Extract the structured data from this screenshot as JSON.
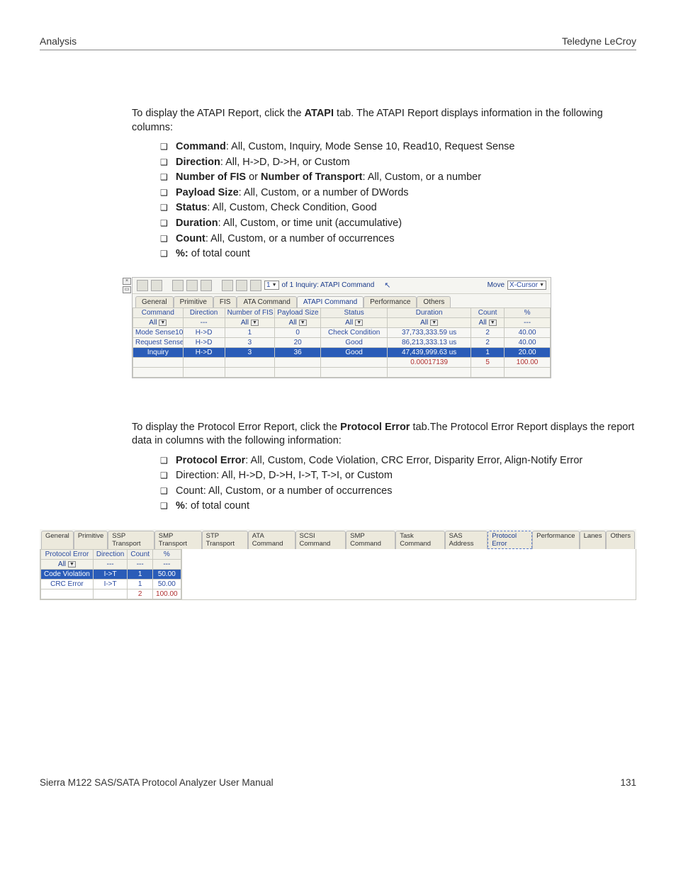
{
  "header": {
    "left": "Analysis",
    "right": "Teledyne LeCroy"
  },
  "atapi_text": {
    "intro_before": "To display the ATAPI Report, click the ",
    "intro_bold": "ATAPI",
    "intro_after": " tab. The ATAPI Report displays information in the following columns:",
    "items": [
      {
        "b": "Command",
        "t": ": All, Custom, Inquiry, Mode Sense 10, Read10, Request Sense"
      },
      {
        "b": "Direction",
        "t": ": All, H->D, D->H, or Custom"
      },
      {
        "b": "Number of FIS",
        "mid": " or ",
        "b2": "Number of Transport",
        "t": ": All, Custom, or a number"
      },
      {
        "b": "Payload Size",
        "t": ": All, Custom, or a number of DWords"
      },
      {
        "b": "Status",
        "t": ": All, Custom, Check Condition, Good"
      },
      {
        "b": "Duration",
        "t": ": All, Custom, or time unit (accumulative)"
      },
      {
        "b": "Count",
        "t": ": All, Custom, or a number of occurrences"
      },
      {
        "b": "%:",
        "t": " of total count"
      }
    ]
  },
  "atapi_ss": {
    "nav_text": "of 1  Inquiry: ATAPI Command",
    "move": "Move",
    "cursor": "X-Cursor",
    "tabs": [
      "General",
      "Primitive",
      "FIS",
      "ATA Command",
      "ATAPI Command",
      "Performance",
      "Others"
    ],
    "active_tab": 4,
    "headers": [
      "Command",
      "Direction",
      "Number of FIS",
      "Payload Size",
      "Status",
      "Duration",
      "Count",
      "%"
    ],
    "filter": [
      "All",
      "---",
      "All",
      "All",
      "All",
      "All",
      "All",
      "---"
    ],
    "rows": [
      [
        "Mode Sense10",
        "H->D",
        "1",
        "0",
        "Check Condition",
        "37,733,333.59  us",
        "2",
        "40.00"
      ],
      [
        "Request Sense",
        "H->D",
        "3",
        "20",
        "Good",
        "86,213,333.13  us",
        "2",
        "40.00"
      ],
      [
        "Inquiry",
        "H->D",
        "3",
        "36",
        "Good",
        "47,439,999.63  us",
        "1",
        "20.00"
      ],
      [
        "",
        "",
        "",
        "",
        "",
        "0.00017139",
        "5",
        "100.00"
      ]
    ],
    "selected_row_index": 2
  },
  "perr_text": {
    "intro_before": "To display the Protocol Error Report, click the ",
    "intro_bold": "Protocol Error",
    "intro_after": " tab.The Protocol Error Report displays the report data in columns with the following information:",
    "items": [
      {
        "b": "Protocol Error",
        "t": ": All, Custom, Code Violation, CRC Error, Disparity Error, Align-Notify Error"
      },
      {
        "plain": "Direction: All, H->D, D->H, I->T, T->I, or Custom"
      },
      {
        "plain": "Count: All, Custom, or a number of occurrences"
      },
      {
        "b": "%",
        "t": ": of total count"
      }
    ]
  },
  "perr_ss": {
    "tabs": [
      "General",
      "Primitive",
      "SSP Transport",
      "SMP Transport",
      "STP Transport",
      "ATA Command",
      "SCSI Command",
      "SMP Command",
      "Task Command",
      "SAS Address",
      "Protocol Error",
      "Performance",
      "Lanes",
      "Others"
    ],
    "active_tab": 10,
    "headers": [
      "Protocol Error",
      "Direction",
      "Count",
      "%"
    ],
    "filter": [
      "All",
      "---",
      "---",
      "---"
    ],
    "rows": [
      [
        "Code Violation",
        "I->T",
        "1",
        "50.00"
      ],
      [
        "CRC Error",
        "I->T",
        "1",
        "50.00"
      ],
      [
        "",
        "",
        "2",
        "100.00"
      ]
    ],
    "selected_row_index": 0
  },
  "footer": {
    "left": "Sierra M122 SAS/SATA Protocol Analyzer User Manual",
    "right": "131"
  }
}
